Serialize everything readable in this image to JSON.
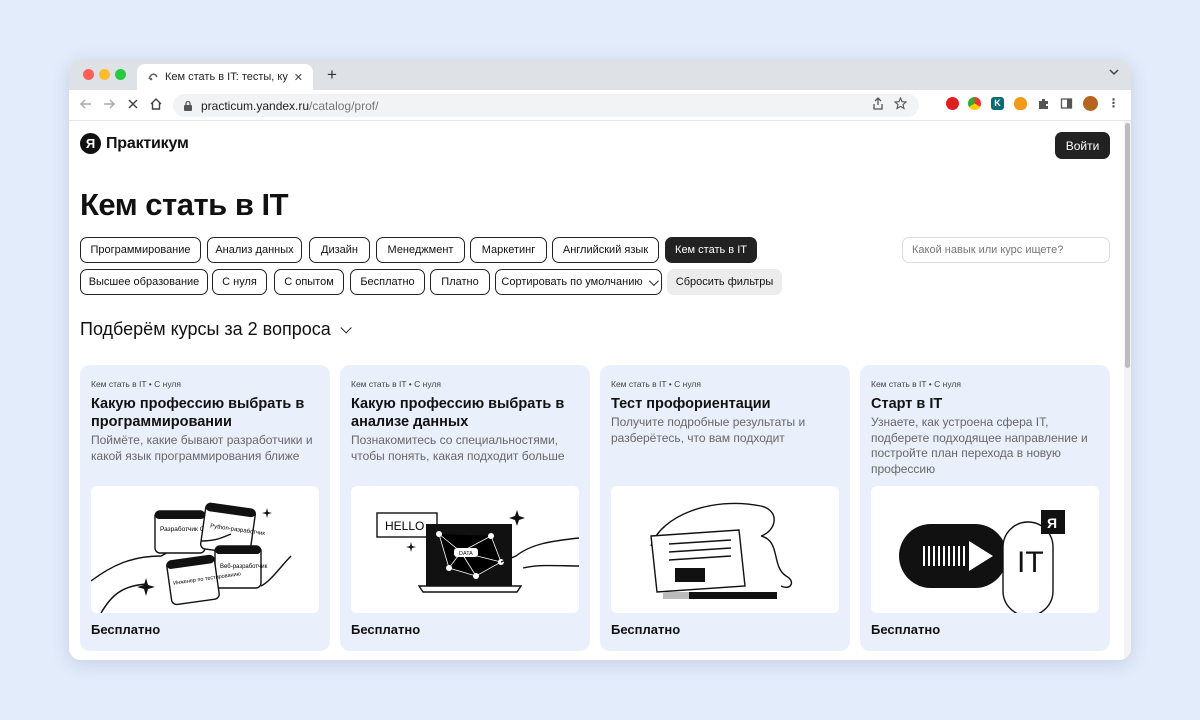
{
  "browser": {
    "tab_title": "Кем стать в IT: тесты, курсы...",
    "new_tab_glyph": "+",
    "url_host": "practicum.yandex.ru",
    "url_path": "/catalog/prof/"
  },
  "header": {
    "logo_glyph": "Я",
    "logo_text": "Практикум",
    "login_label": "Войти"
  },
  "page_title": "Кем стать в IT",
  "filters_row1": [
    "Программирование",
    "Анализ данных",
    "Дизайн",
    "Менеджмент",
    "Маркетинг",
    "Английский язык",
    "Кем стать в IT"
  ],
  "active_filter": "Кем стать в IT",
  "filters_row2": [
    "Высшее образование",
    "С нуля",
    "С опытом",
    "Бесплатно",
    "Платно"
  ],
  "sort_label": "Сортировать по умолчанию",
  "reset_label": "Сбросить фильтры",
  "search_placeholder": "Какой навык или курс ищете?",
  "quiz_title": "Подберём курсы за 2 вопроса",
  "cards": [
    {
      "crumb": "Кем стать в IT • С нуля",
      "title": "Какую профессию выбрать в программировании",
      "desc": "Поймёте, какие бывают разработчики и какой язык программирования ближе",
      "price": "Бесплатно",
      "illustration": [
        "Разработчик C++",
        "Python-разработчик",
        "Веб-разработчик",
        "Инженер по тестированию"
      ]
    },
    {
      "crumb": "Кем стать в IT • С нуля",
      "title": "Какую профессию выбрать в анализе данных",
      "desc": "Познакомитесь со специальностями, чтобы понять, какая подходит больше",
      "price": "Бесплатно",
      "illustration": [
        "HELLO",
        "DATA"
      ]
    },
    {
      "crumb": "Кем стать в IT • С нуля",
      "title": "Тест профориентации",
      "desc": "Получите подробные результаты и разберётесь, что вам подходит",
      "price": "Бесплатно"
    },
    {
      "crumb": "Кем стать в IT • С нуля",
      "title": "Старт в IT",
      "desc": "Узнаете, как устроена сфера IT, подберете подходящее направление и постройте план перехода в новую профессию",
      "price": "Бесплатно",
      "illustration": [
        "IT",
        "Я"
      ]
    }
  ],
  "colors": {
    "page_bg": "#e3ecfb",
    "card_bg": "#eaf0fb",
    "accent_dark": "#222222"
  },
  "icons": [
    "back-icon",
    "forward-icon",
    "stop-icon",
    "home-icon",
    "lock-icon",
    "share-icon",
    "star-icon",
    "extensions-icon",
    "sidebar-icon",
    "avatar"
  ]
}
